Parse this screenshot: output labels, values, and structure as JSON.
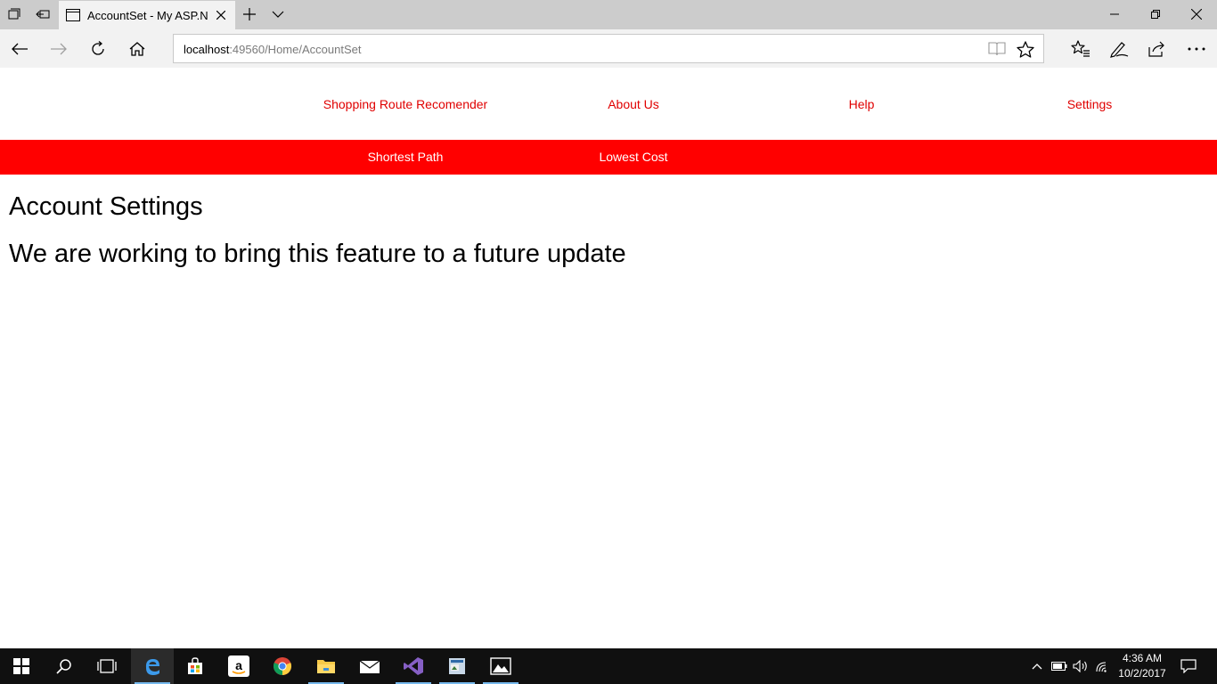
{
  "browser": {
    "tab_title": "AccountSet - My ASP.N",
    "url_host": "localhost",
    "url_rest": ":49560/Home/AccountSet"
  },
  "site": {
    "nav": [
      "Shopping Route Recomender",
      "About Us",
      "Help",
      "Settings"
    ],
    "subnav": [
      "Shortest Path",
      "Lowest Cost"
    ],
    "accent_color": "#ff0000"
  },
  "page": {
    "heading": "Account Settings",
    "message": "We are working to bring this feature to a future update"
  },
  "taskbar": {
    "time": "4:36 AM",
    "date": "10/2/2017"
  }
}
